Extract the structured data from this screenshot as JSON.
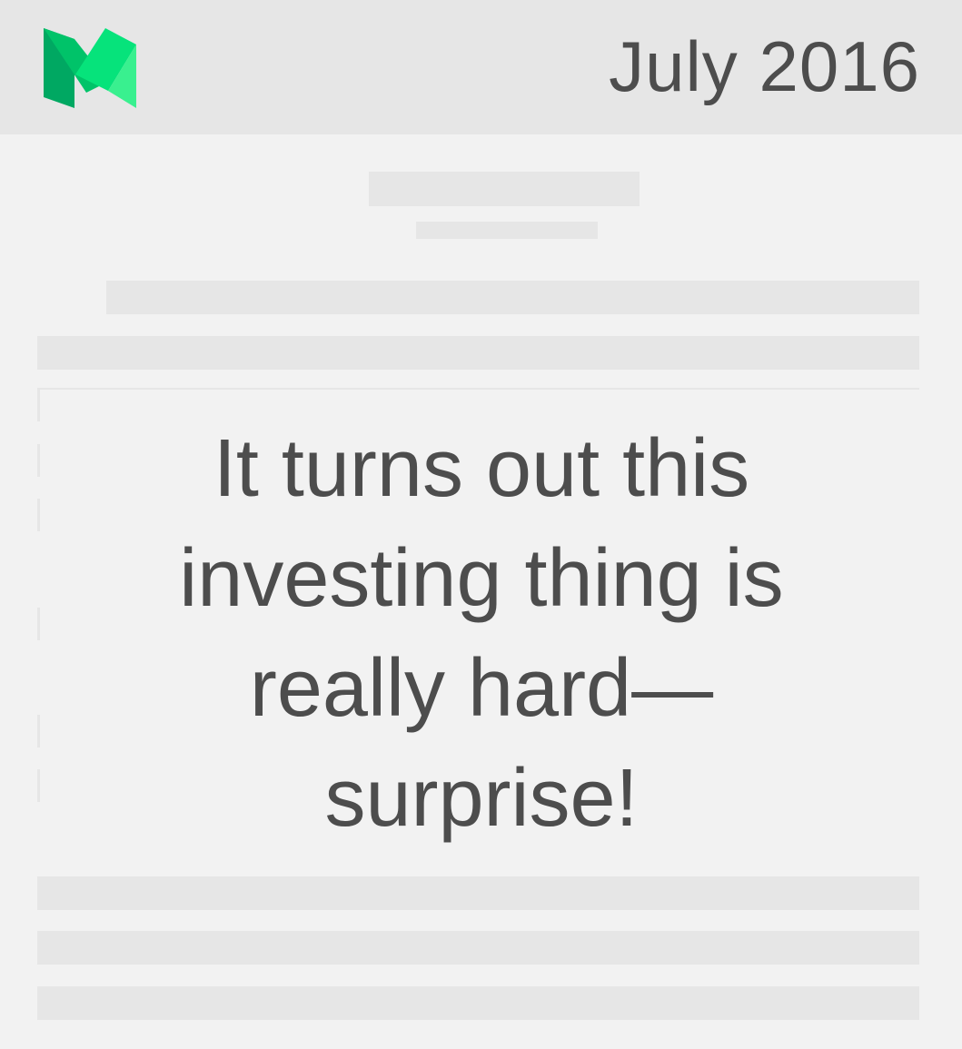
{
  "header": {
    "date": "July 2016",
    "logo_icon": "medium-logo-icon",
    "background": "#e6e6e6"
  },
  "quote": {
    "lines": [
      "It turns out this",
      "investing thing is",
      "really hard—",
      "surprise!"
    ],
    "color": "#4d4d4d"
  },
  "colors": {
    "page_background": "#f2f2f2",
    "placeholder_bar": "#e6e6e6",
    "logo_green_dark": "#00a862",
    "logo_green_mid": "#00c369",
    "logo_green_bright": "#06e37b",
    "logo_green_light": "#39f08f"
  }
}
